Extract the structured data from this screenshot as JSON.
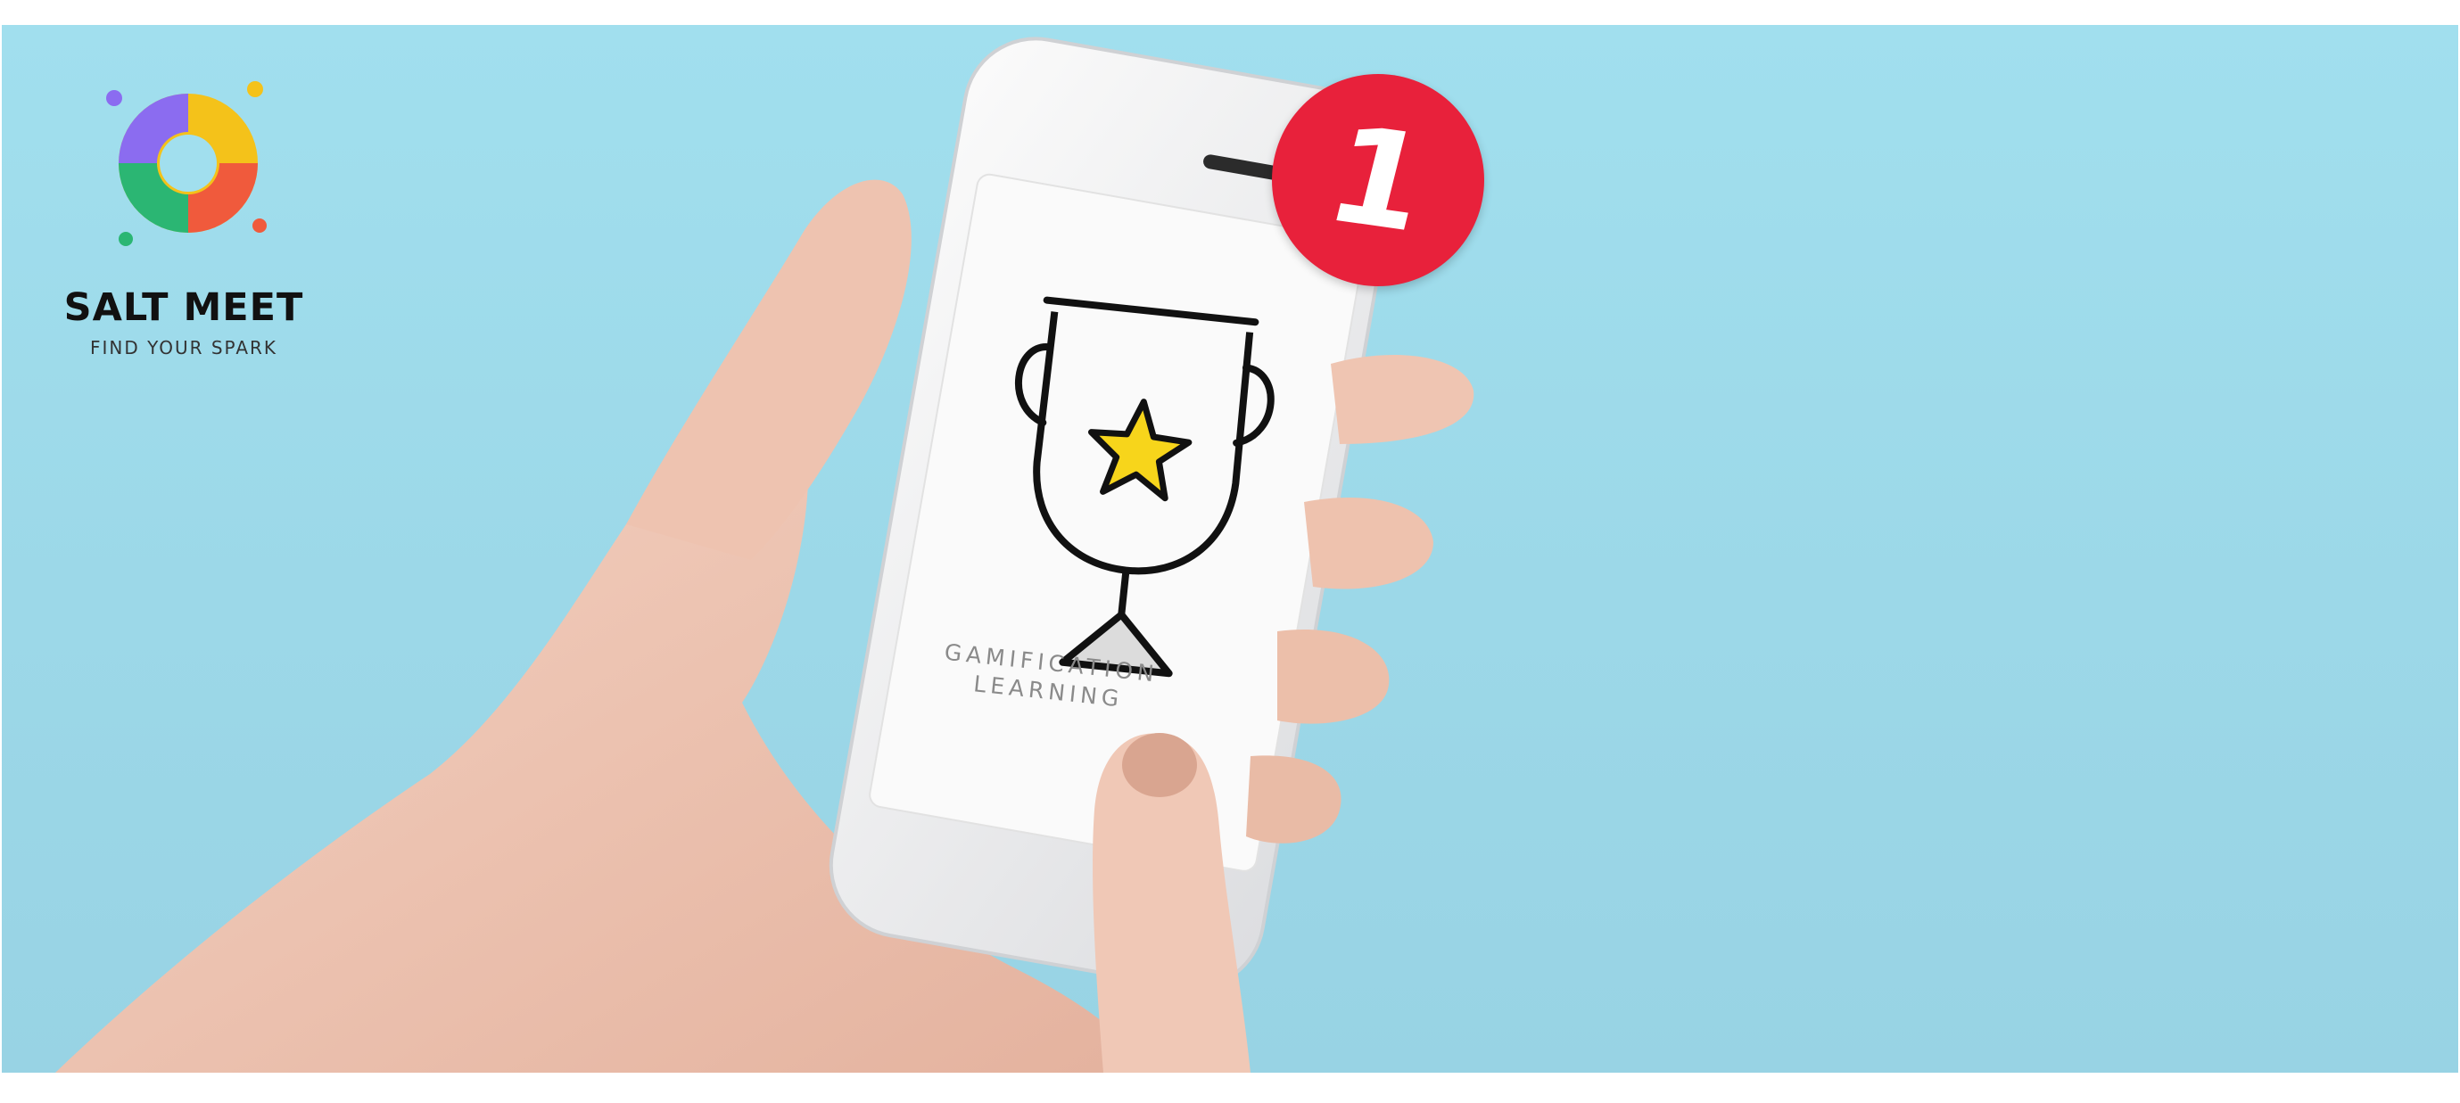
{
  "brand": {
    "name": "SALT MEET",
    "tagline": "FIND YOUR SPARK"
  },
  "phone": {
    "screen_text_line1": "GAMIFICATION",
    "screen_text_line2": "LEARNING"
  },
  "notification": {
    "count": "1"
  },
  "colors": {
    "background": "#a1dfee",
    "badge": "#e8213b",
    "star": "#f7d51b"
  }
}
